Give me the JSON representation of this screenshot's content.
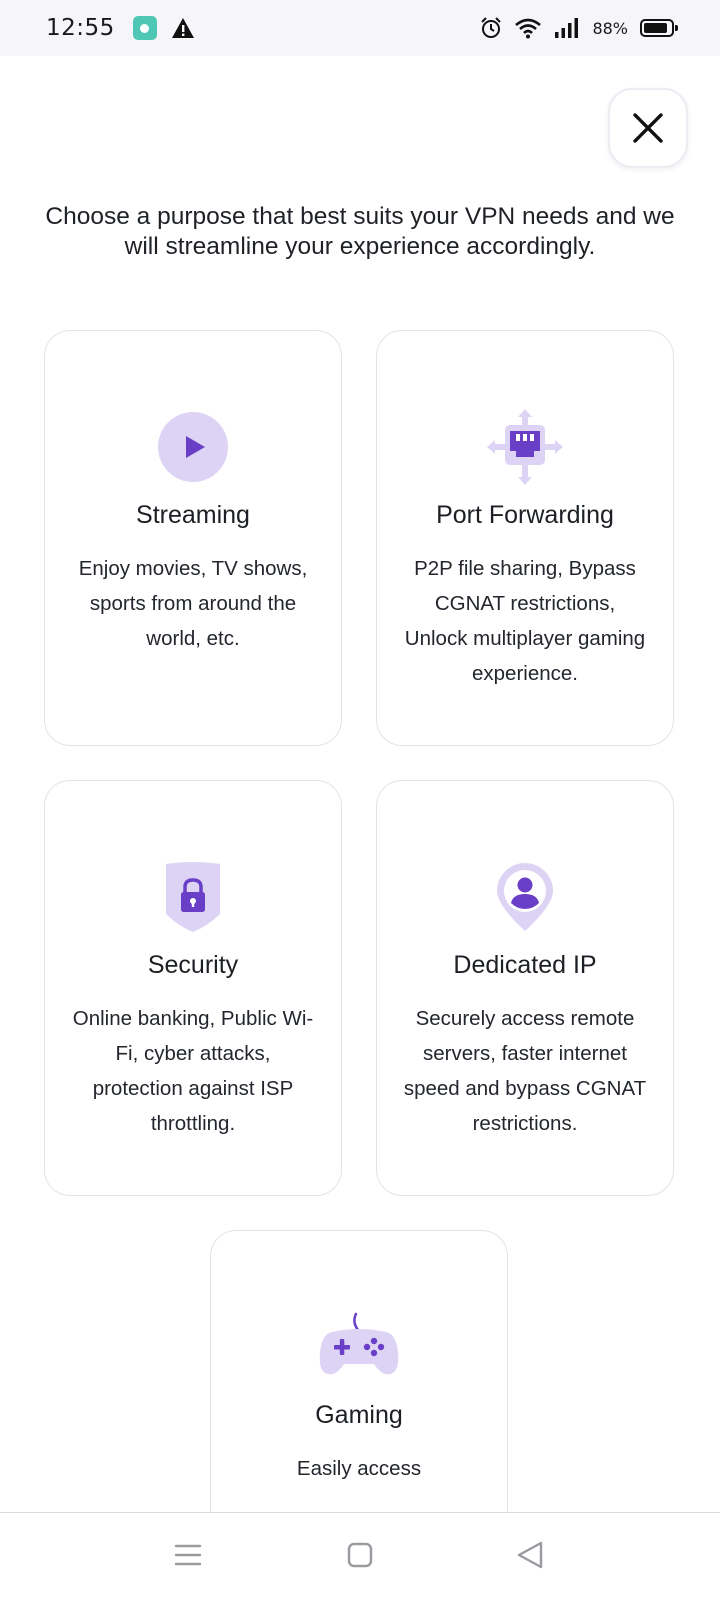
{
  "status_bar": {
    "time": "12:55",
    "battery": "88%",
    "battery_level": 0.88
  },
  "close_icon": "close-icon",
  "intro_text": "Choose a purpose that best suits your VPN needs and we will streamline your experience accordingly.",
  "colors": {
    "accent": "#6a3fc7",
    "accent_light": "#ddd4f5",
    "card_border": "#e4e2ea"
  },
  "purposes": [
    {
      "title": "Streaming",
      "description": "Enjoy movies, TV shows, sports from around the world, etc.",
      "icon": "play-icon"
    },
    {
      "title": "Port Forwarding",
      "description": "P2P file sharing, Bypass CGNAT restrictions, Unlock multiplayer gaming experience.",
      "icon": "ethernet-port-icon"
    },
    {
      "title": "Security",
      "description": "Online banking, Public Wi-Fi, cyber attacks, protection against ISP throttling.",
      "icon": "shield-lock-icon"
    },
    {
      "title": "Dedicated IP",
      "description": "Securely access remote servers, faster internet speed and bypass CGNAT restrictions.",
      "icon": "user-pin-icon"
    },
    {
      "title": "Gaming",
      "description": "Easily access",
      "icon": "gamepad-icon"
    }
  ],
  "nav": {
    "menu_icon": "menu-icon",
    "home_icon": "home-square-icon",
    "back_icon": "back-triangle-icon"
  }
}
